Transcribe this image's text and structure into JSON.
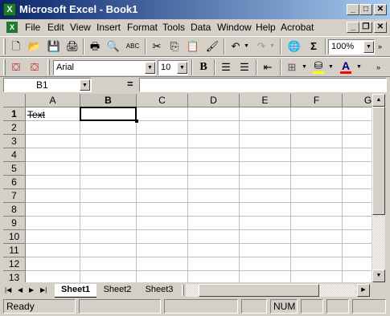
{
  "window": {
    "title": "Microsoft Excel - Book1"
  },
  "menu": {
    "items": [
      {
        "label": "File"
      },
      {
        "label": "Edit"
      },
      {
        "label": "View"
      },
      {
        "label": "Insert"
      },
      {
        "label": "Format"
      },
      {
        "label": "Tools"
      },
      {
        "label": "Data"
      },
      {
        "label": "Window"
      },
      {
        "label": "Help"
      },
      {
        "label": "Acrobat"
      }
    ]
  },
  "toolbar": {
    "zoom": "100%",
    "font_name": "Arial",
    "font_size": "10",
    "sum_symbol": "Σ",
    "bold_label": "B",
    "font_color_label": "A"
  },
  "formula_bar": {
    "name_box": "B1",
    "equals": "=",
    "content": ""
  },
  "grid": {
    "columns": [
      "A",
      "B",
      "C",
      "D",
      "E",
      "F",
      "G"
    ],
    "rows": [
      "1",
      "2",
      "3",
      "4",
      "5",
      "6",
      "7",
      "8",
      "9",
      "10",
      "11",
      "12",
      "13"
    ],
    "cell_A1": "Text",
    "active_cell": "B1"
  },
  "sheets": {
    "tabs": [
      {
        "label": "Sheet1"
      },
      {
        "label": "Sheet2"
      },
      {
        "label": "Sheet3"
      }
    ],
    "active": "Sheet1"
  },
  "status": {
    "mode": "Ready",
    "num": "NUM"
  },
  "colors": {
    "title_start": "#0a246a",
    "title_end": "#a6caf0",
    "chrome": "#d4d0c8",
    "font_color_bar": "#ff0000",
    "fill_color_bar": "#ffff00"
  }
}
